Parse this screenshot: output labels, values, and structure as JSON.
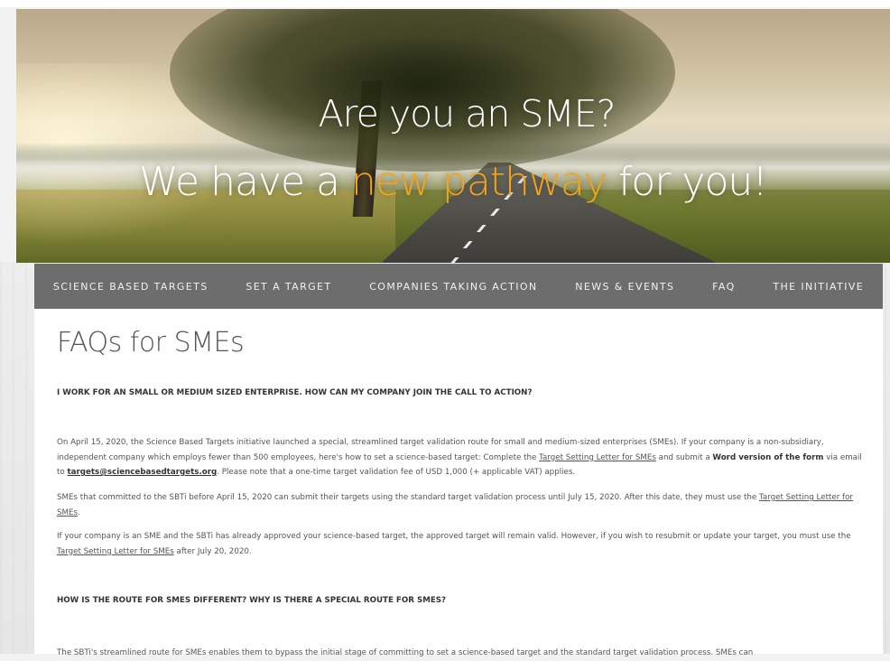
{
  "banner": {
    "line1": "Are you an SME?",
    "line2_start": "We have a ",
    "line2_highlight": "new pathway",
    "line2_end": " for you!",
    "highlight_color": "#f2a41c"
  },
  "nav": {
    "items": [
      "SCIENCE BASED TARGETS",
      "SET A TARGET",
      "COMPANIES TAKING ACTION",
      "NEWS & EVENTS",
      "FAQ",
      "THE INITIATIVE"
    ],
    "background": "#6d6d6d"
  },
  "page": {
    "title": "FAQs for SMEs"
  },
  "faq": {
    "q1": "I WORK FOR AN SMALL OR MEDIUM SIZED ENTERPRISE. HOW CAN MY COMPANY JOIN THE CALL TO ACTION?",
    "p1": {
      "text_a": "On April 15, 2020, the Science Based Targets initiative launched a special, streamlined target validation route for small and medium-sized enterprises (SMEs). If your company is a non-subsidiary, independent company which employs fewer than 500 employees, here's how to set a science-based target: Complete the ",
      "link_letter": "Target Setting Letter for SMEs",
      "text_b": " and submit a ",
      "bold_form": "Word version of the form",
      "text_c": " via email to ",
      "email": "targets@sciencebasedtargets.org",
      "text_d": ". Please note that a one-time target validation fee of USD 1,000 (+ applicable VAT) applies."
    },
    "p2": {
      "text_a": "SMEs that committed to the SBTi before April 15, 2020 can submit their targets using the standard target validation process until July 15, 2020. After this date, they must use the ",
      "link": "Target Setting Letter for SMEs",
      "text_b": "."
    },
    "p3": {
      "text_a": "If your company is an SME and the SBTi has already approved your science-based target, the approved target will remain valid. However, if you wish to resubmit or update your target, you must use the ",
      "link": "Target Setting Letter for SMEs",
      "text_b": " after July 20, 2020."
    },
    "q2": "HOW IS THE ROUTE FOR SMES DIFFERENT? WHY IS THERE A SPECIAL ROUTE FOR SMES?",
    "p4": "The SBTi's streamlined route for SMEs enables them to bypass the initial stage of committing to set a science-based target and the standard target validation process. SMEs can"
  }
}
